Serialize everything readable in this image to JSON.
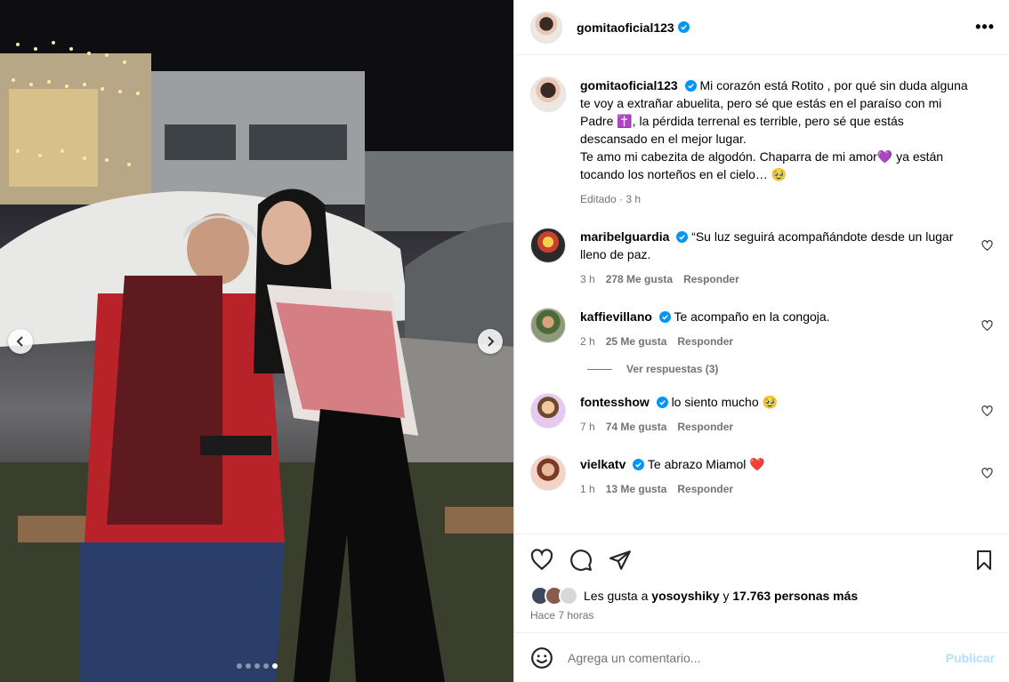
{
  "post": {
    "author": "gomitaoficial123",
    "caption_lines": [
      "Mi corazón está Rotito , por qué sin duda alguna te voy a extrañar abuelita, pero sé que estás en el paraíso con mi Padre ✝️, la pérdida terrenal es terrible, pero sé que estás descansado en el mejor lugar.",
      "Te amo mi cabezita de algodón. Chaparra de mi amor💜 ya están tocando los norteños en el cielo… 🥹"
    ],
    "caption_meta": "Editado · 3 h",
    "more_label": "•••"
  },
  "comments": [
    {
      "user": "maribelguardia",
      "text": "“Su luz seguirá acompañándote desde un lugar lleno de paz.",
      "time": "3 h",
      "likes": "278 Me gusta",
      "reply": "Responder"
    },
    {
      "user": "kaffievillano",
      "text": "Te acompaño en la congoja.",
      "time": "2 h",
      "likes": "25 Me gusta",
      "reply": "Responder",
      "view_replies": "Ver respuestas (3)"
    },
    {
      "user": "fontesshow",
      "text": "lo siento mucho 🥹",
      "time": "7 h",
      "likes": "74 Me gusta",
      "reply": "Responder"
    },
    {
      "user": "vielkatv",
      "text": "Te abrazo Miamol ❤️",
      "time": "1 h",
      "likes": "13 Me gusta",
      "reply": "Responder"
    }
  ],
  "likes_bar": {
    "prefix": "Les gusta a",
    "first_user": "yosoyshiky",
    "connector": "y",
    "others": "17.763 personas más",
    "posted": "Hace 7 horas"
  },
  "comment_box": {
    "placeholder": "Agrega un comentario...",
    "publish_label": "Publicar"
  },
  "carousel": {
    "slide_count": 5,
    "active_index": 4
  },
  "colors": {
    "verified": "#0095f6",
    "muted": "#737373",
    "publish_disabled": "#b2dffc"
  },
  "icons": [
    "heart-icon",
    "comment-icon",
    "share-icon",
    "bookmark-icon",
    "emoji-icon",
    "verified-icon",
    "chevron-left-icon",
    "chevron-right-icon"
  ]
}
